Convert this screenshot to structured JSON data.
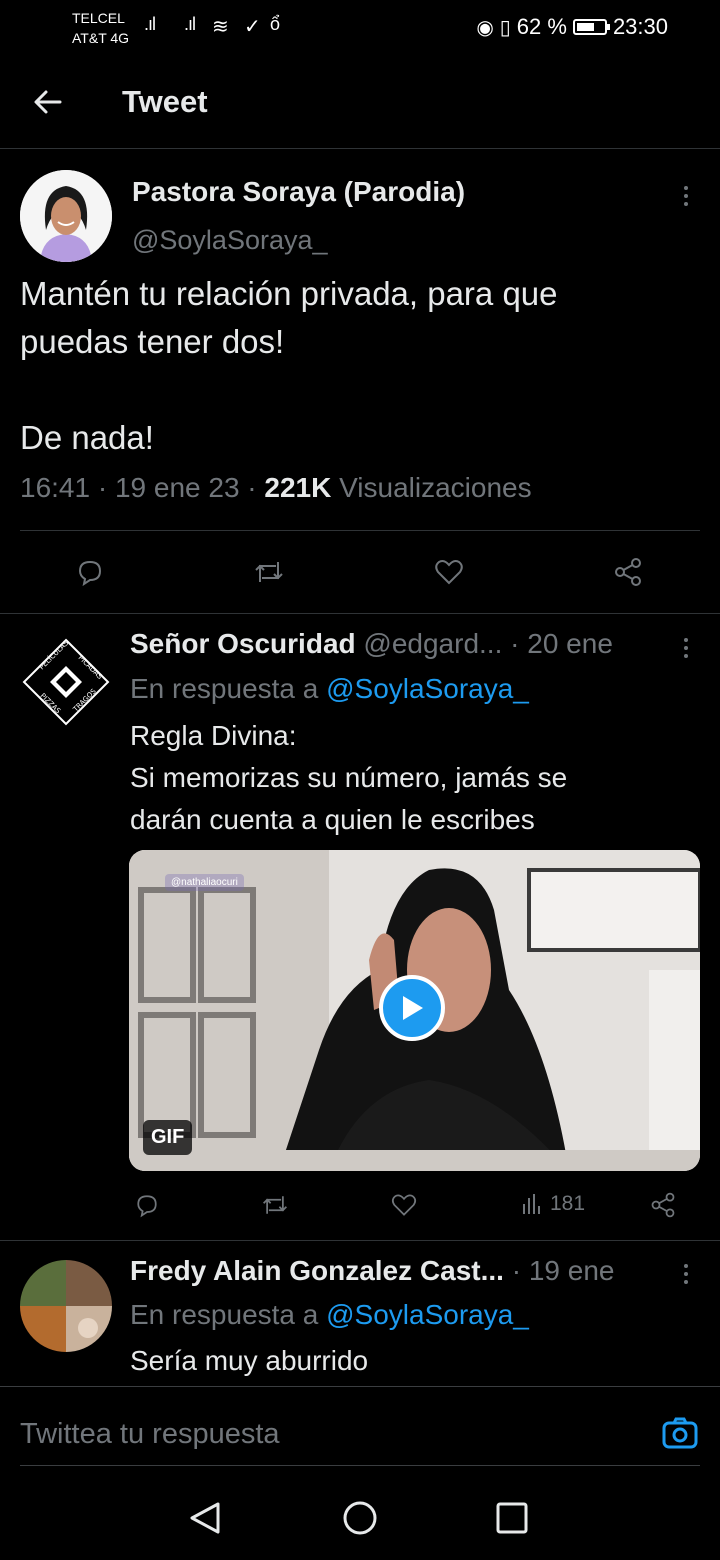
{
  "status_bar": {
    "carrier1": "TELCEL",
    "carrier2": "AT&T 4G",
    "battery": "62 %",
    "time": "23:30"
  },
  "header": {
    "title": "Tweet"
  },
  "main_tweet": {
    "name": "Pastora Soraya (Parodia)",
    "handle": "@SoylaSoraya_",
    "text": "Mantén tu relación privada, para que\npuedas tener dos!\n\nDe nada!",
    "time": "16:41 · 19 ene 23 · ",
    "views_count": "221K",
    "views_label": " Visualizaciones"
  },
  "replies": [
    {
      "name": "Señor Oscuridad",
      "handle": "@edgard...",
      "date": "· 20 ene",
      "reply_prefix": "En respuesta a ",
      "reply_to": "@SoylaSoraya_",
      "text": "Regla Divina:\nSi memorizas su número, jamás se\ndarán cuenta a quien le escribes",
      "avatar_text": "PELÍCULAS · PICADAS · PIZZAS · TRAGOS",
      "media": {
        "badge": "GIF",
        "watermark": "@nathaliaocuri"
      },
      "views": "181"
    },
    {
      "name": "Fredy Alain Gonzalez Cast...",
      "date": "· 19 ene",
      "reply_prefix": "En respuesta a ",
      "reply_to": "@SoylaSoraya_",
      "text": "Sería muy aburrido"
    }
  ],
  "composer": {
    "placeholder": "Twittea tu respuesta"
  },
  "colors": {
    "accent": "#1d9bf0",
    "muted": "#71767b",
    "text": "#e7e9ea",
    "background": "#000000"
  }
}
